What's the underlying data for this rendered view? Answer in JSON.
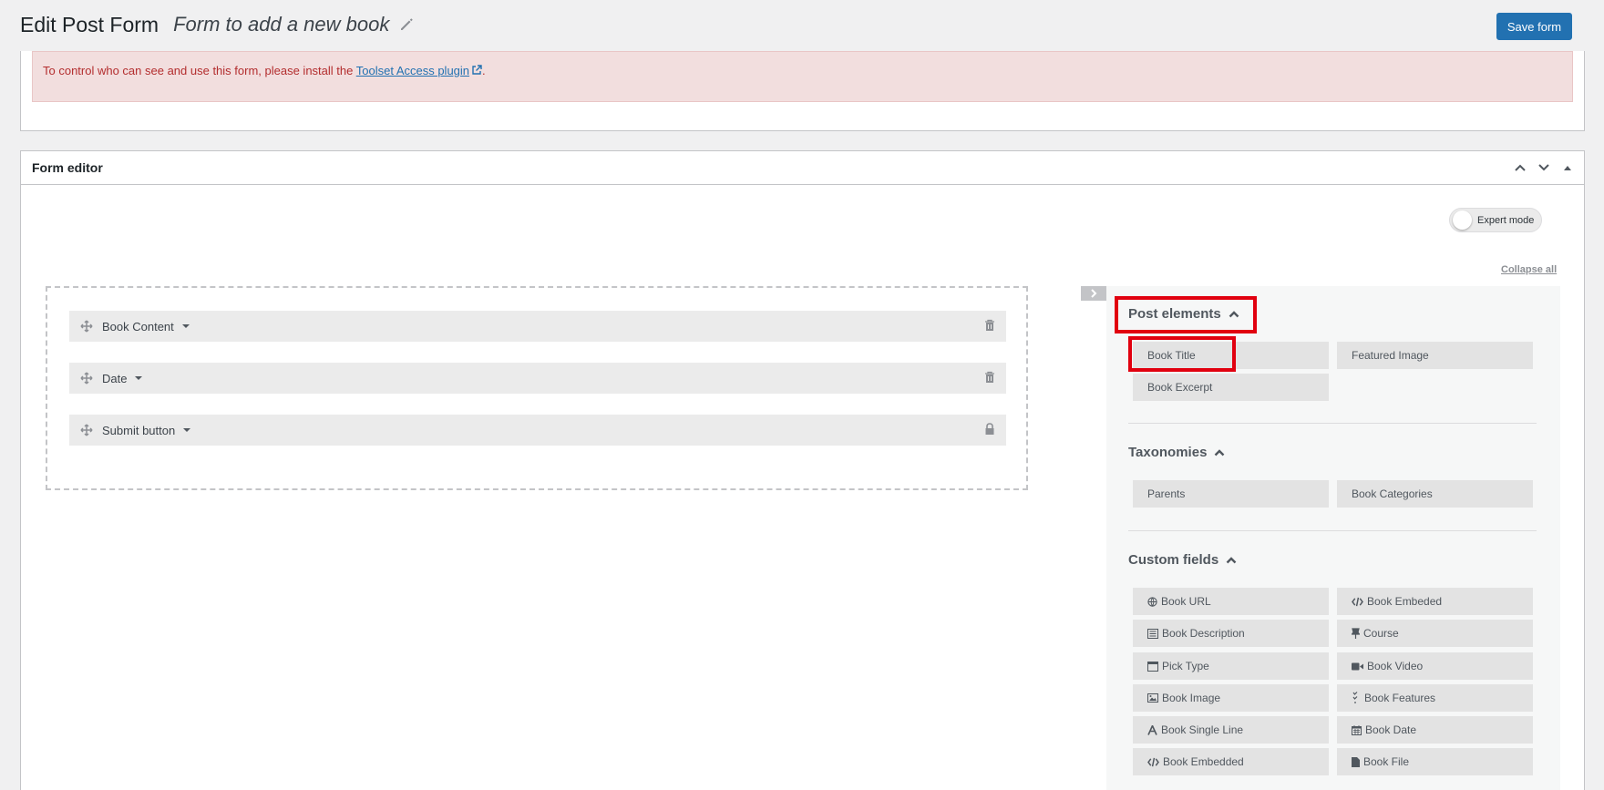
{
  "header": {
    "page_title": "Edit Post Form",
    "form_name": "Form to add a new book",
    "save_label": "Save form"
  },
  "notice": {
    "text": "To control who can see and use this form, please install the ",
    "link": "Toolset Access plugin",
    "suffix": "."
  },
  "editor": {
    "title": "Form editor",
    "expert_mode": "Expert mode",
    "collapse_all": "Collapse all",
    "fields": [
      {
        "label": "Book Content",
        "icon": "trash-icon"
      },
      {
        "label": "Date",
        "icon": "trash-icon"
      },
      {
        "label": "Submit button",
        "icon": "lock-icon"
      }
    ]
  },
  "sidebar": {
    "post_elements": {
      "title": "Post elements",
      "items": [
        "Book Title",
        "Featured Image",
        "Book Excerpt"
      ]
    },
    "taxonomies": {
      "title": "Taxonomies",
      "items": [
        "Parents",
        "Book Categories"
      ]
    },
    "custom_fields": {
      "title": "Custom fields",
      "items": [
        {
          "label": "Book URL",
          "icon": "globe-icon"
        },
        {
          "label": "Book Embeded",
          "icon": "code-icon"
        },
        {
          "label": "Book Description",
          "icon": "paragraph-icon"
        },
        {
          "label": "Course",
          "icon": "pin-icon"
        },
        {
          "label": "Pick Type",
          "icon": "window-icon"
        },
        {
          "label": "Book Video",
          "icon": "video-icon"
        },
        {
          "label": "Book Image",
          "icon": "image-icon"
        },
        {
          "label": "Book Features",
          "icon": "checklist-icon"
        },
        {
          "label": "Book Single Line",
          "icon": "font-icon"
        },
        {
          "label": "Book Date",
          "icon": "calendar-icon"
        },
        {
          "label": "Book Embedded",
          "icon": "code-icon"
        },
        {
          "label": "Book File",
          "icon": "file-icon"
        }
      ]
    }
  },
  "colors": {
    "accent": "#2271b1",
    "highlight": "#e1000f",
    "notice_bg": "#f2dede",
    "notice_text": "#b32d2e"
  }
}
